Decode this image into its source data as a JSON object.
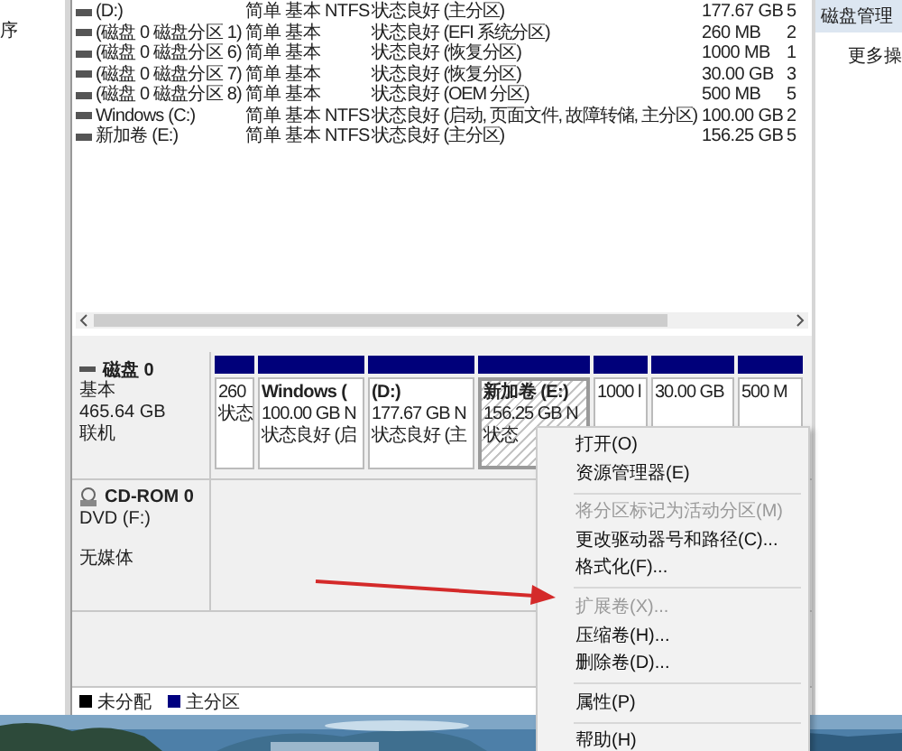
{
  "nav_pane": {
    "text": "序"
  },
  "volumes_table": {
    "rows": [
      {
        "volume": "(D:)",
        "layout": "简单",
        "type": "基本",
        "file_system": "NTFS",
        "status": "状态良好 (主分区)",
        "capacity": "177.67 GB",
        "column_7": "5"
      },
      {
        "volume": "(磁盘 0 磁盘分区 1)",
        "layout": "简单",
        "type": "基本",
        "status": "状态良好 (EFI 系统分区)",
        "capacity": "260 MB",
        "column_7": "2"
      },
      {
        "volume": "(磁盘 0 磁盘分区 6)",
        "layout": "简单",
        "type": "基本",
        "status": "状态良好 (恢复分区)",
        "capacity": "1000 MB",
        "column_7": "1"
      },
      {
        "volume": "(磁盘 0 磁盘分区 7)",
        "layout": "简单",
        "type": "基本",
        "status": "状态良好 (恢复分区)",
        "capacity": "30.00 GB",
        "column_7": "3"
      },
      {
        "volume": "(磁盘 0 磁盘分区 8)",
        "layout": "简单",
        "type": "基本",
        "status": "状态良好 (OEM 分区)",
        "capacity": "500 MB",
        "column_7": "5"
      },
      {
        "volume": "Windows (C:)",
        "layout": "简单",
        "type": "基本",
        "file_system": "NTFS",
        "status": "状态良好 (启动, 页面文件, 故障转储, 主分区)",
        "capacity": "100.00 GB",
        "column_7": "2"
      },
      {
        "volume": "新加卷 (E:)",
        "layout": "简单",
        "type": "基本",
        "file_system": "NTFS",
        "status": "状态良好 (主分区)",
        "capacity": "156.25 GB",
        "column_7": "5"
      }
    ]
  },
  "disks": [
    {
      "kind": "disk",
      "name": "磁盘 0",
      "lines": [
        "基本",
        "465.64 GB",
        "联机"
      ],
      "partitions": [
        {
          "lines": [
            "260",
            "状态"
          ],
          "selected": false
        },
        {
          "title": "Windows (",
          "lines": [
            "100.00 GB N",
            "状态良好 (启"
          ],
          "selected": false
        },
        {
          "title": "(D:)",
          "lines": [
            "177.67 GB N",
            "状态良好 (主"
          ],
          "selected": false
        },
        {
          "title": "新加卷  (E:)",
          "lines": [
            "156.25 GB N",
            "状态"
          ],
          "selected": true
        },
        {
          "lines": [
            "1000 l"
          ],
          "selected": false
        },
        {
          "lines": [
            "30.00 GB"
          ],
          "selected": false
        },
        {
          "lines": [
            "500 M"
          ],
          "selected": false
        }
      ]
    },
    {
      "kind": "cdrom",
      "name": "CD-ROM 0",
      "lines": [
        "DVD (F:)",
        "无媒体"
      ]
    }
  ],
  "legend": [
    {
      "label": "未分配",
      "color": "#000000"
    },
    {
      "label": "主分区",
      "color": "#000080"
    }
  ],
  "actions_pane": {
    "header": "磁盘管理",
    "items": [
      "更多操"
    ]
  },
  "context_menu": {
    "items": [
      {
        "kind": "item",
        "label": "打开(O)",
        "disabled": false
      },
      {
        "kind": "item",
        "label": "资源管理器(E)",
        "disabled": false
      },
      {
        "kind": "separator"
      },
      {
        "kind": "item",
        "label": "将分区标记为活动分区(M)",
        "disabled": true
      },
      {
        "kind": "item",
        "label": "更改驱动器号和路径(C)...",
        "disabled": false
      },
      {
        "kind": "item",
        "label": "格式化(F)...",
        "disabled": false
      },
      {
        "kind": "separator"
      },
      {
        "kind": "item",
        "label": "扩展卷(X)...",
        "disabled": true
      },
      {
        "kind": "item",
        "label": "压缩卷(H)...",
        "disabled": false
      },
      {
        "kind": "item",
        "label": "删除卷(D)...",
        "disabled": false
      },
      {
        "kind": "separator"
      },
      {
        "kind": "item",
        "label": "属性(P)",
        "disabled": false
      },
      {
        "kind": "separator"
      },
      {
        "kind": "item",
        "label": "帮助(H)",
        "disabled": false
      }
    ]
  }
}
